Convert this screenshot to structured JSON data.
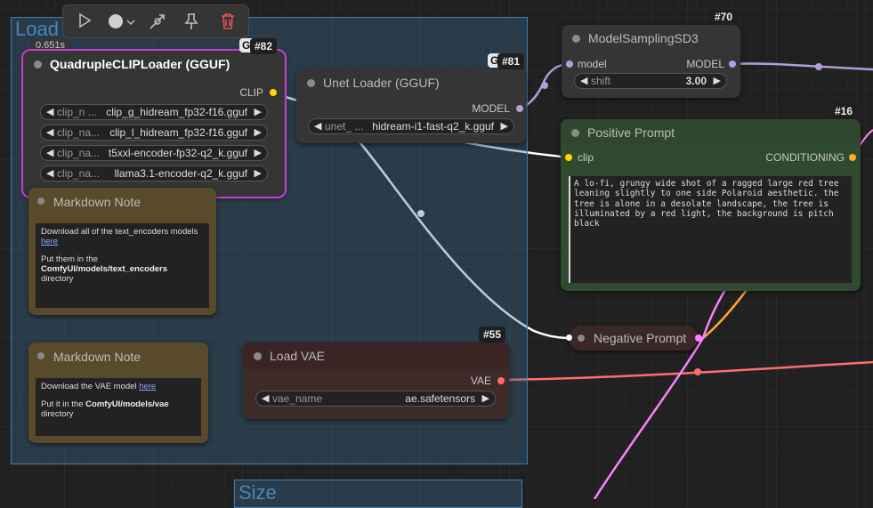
{
  "toolbar": {
    "icons": [
      "play-icon",
      "color-circle-icon",
      "chevron-down-icon",
      "bypass-icon",
      "pin-icon",
      "trash-icon"
    ]
  },
  "groups": [
    {
      "title": "Load"
    },
    {
      "title": "Size"
    }
  ],
  "timing": "0.651s",
  "nodes": {
    "quad": {
      "badge": "#82",
      "group_tag": "G",
      "title": "QuadrupleCLIPLoader (GGUF)",
      "output": "CLIP",
      "widgets": [
        {
          "name": "clip_n ...",
          "value": "clip_g_hidream_fp32-f16.gguf"
        },
        {
          "name": "clip_na...",
          "value": "clip_l_hidream_fp32-f16.gguf"
        },
        {
          "name": "clip_na...",
          "value": "t5xxl-encoder-fp32-q2_k.gguf"
        },
        {
          "name": "clip_na...",
          "value": "llama3.1-encoder-q2_k.gguf"
        }
      ]
    },
    "unet": {
      "badge": "#81",
      "group_tag": "G",
      "title": "Unet Loader (GGUF)",
      "output": "MODEL",
      "widget": {
        "name": "unet_ ...",
        "value": "hidream-i1-fast-q2_k.gguf"
      }
    },
    "msd3": {
      "badge": "#70",
      "title": "ModelSamplingSD3",
      "input": "model",
      "output": "MODEL",
      "widget": {
        "name": "shift",
        "value": "3.00"
      }
    },
    "pos": {
      "badge": "#16",
      "title": "Positive Prompt",
      "input": "clip",
      "output": "CONDITIONING",
      "text": "A lo-fi, grungy wide shot of a ragged large red tree leaning slightly to one side Polaroid aesthetic. the tree is alone in a desolate landscape, the tree is illuminated by a red light, the background is pitch black"
    },
    "neg": {
      "title": "Negative Prompt"
    },
    "vae": {
      "badge": "#55",
      "title": "Load VAE",
      "output": "VAE",
      "widget": {
        "name": "vae_name",
        "value": "ae.safetensors"
      }
    },
    "md1": {
      "title": "Markdown Note",
      "line1": "Download all of the text_encoders models",
      "link1": "here",
      "line2": "Put them in the",
      "bold2": "ComfyUI/models/text_encoders",
      "line3": "directory"
    },
    "md2": {
      "title": "Markdown Note",
      "line1": "Download the VAE model",
      "link1": "here",
      "line2": "Put it in the",
      "bold2": "ComfyUI/models/vae",
      "line3": "directory"
    }
  },
  "colors": {
    "clip": "#ffd500",
    "model": "#b39ddb",
    "vae": "#ff6e6e",
    "conditioning": "#ffa931",
    "selected": "#c83ccf"
  }
}
